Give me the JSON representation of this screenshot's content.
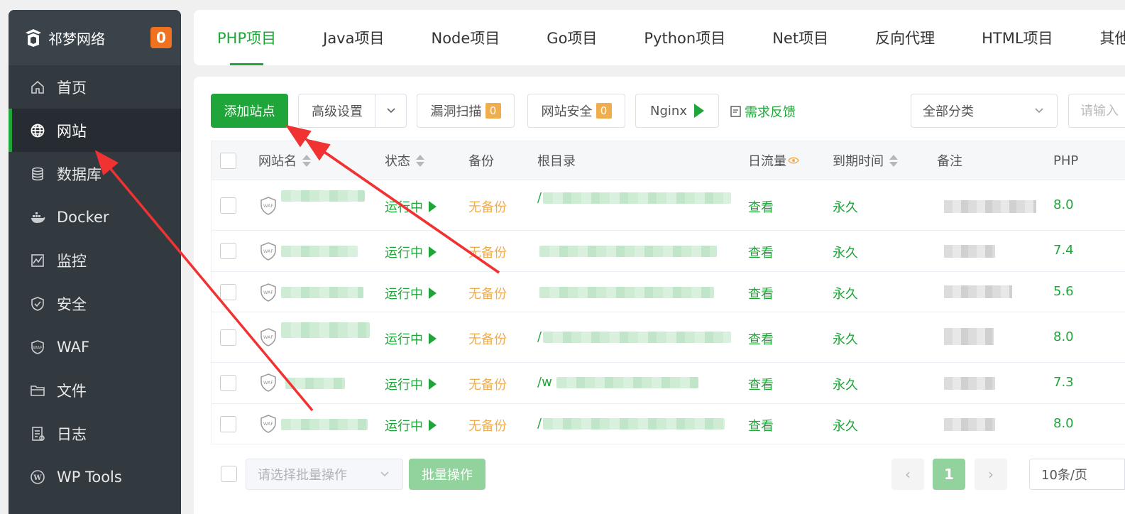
{
  "sidebar": {
    "brand": "祁梦网络",
    "badge": "0",
    "items": [
      {
        "label": "首页",
        "icon": "home-icon"
      },
      {
        "label": "网站",
        "icon": "globe-icon"
      },
      {
        "label": "数据库",
        "icon": "database-icon"
      },
      {
        "label": "Docker",
        "icon": "docker-icon"
      },
      {
        "label": "监控",
        "icon": "monitor-icon"
      },
      {
        "label": "安全",
        "icon": "shield-icon"
      },
      {
        "label": "WAF",
        "icon": "waf-icon"
      },
      {
        "label": "文件",
        "icon": "folder-icon"
      },
      {
        "label": "日志",
        "icon": "log-icon"
      },
      {
        "label": "WP Tools",
        "icon": "wordpress-icon"
      }
    ],
    "active_index": 1
  },
  "tabs": [
    "PHP项目",
    "Java项目",
    "Node项目",
    "Go项目",
    "Python项目",
    "Net项目",
    "反向代理",
    "HTML项目",
    "其他"
  ],
  "toolbar": {
    "add_site": "添加站点",
    "advanced": "高级设置",
    "scan": "漏洞扫描",
    "scan_count": "0",
    "security": "网站安全",
    "security_count": "0",
    "nginx": "Nginx",
    "feedback": "需求反馈",
    "category": "全部分类",
    "search_placeholder": "请输入"
  },
  "table": {
    "headers": {
      "name": "网站名",
      "status": "状态",
      "backup": "备份",
      "root": "根目录",
      "traffic": "日流量",
      "expire": "到期时间",
      "note": "备注",
      "php": "PHP"
    },
    "rows": [
      {
        "status": "运行中",
        "backup": "无备份",
        "root": "/",
        "traffic": "查看",
        "expire": "永久",
        "php": "8.0"
      },
      {
        "status": "运行中",
        "backup": "无备份",
        "root": "",
        "traffic": "查看",
        "expire": "永久",
        "php": "7.4"
      },
      {
        "status": "运行中",
        "backup": "无备份",
        "root": "",
        "traffic": "查看",
        "expire": "永久",
        "php": "5.6"
      },
      {
        "status": "运行中",
        "backup": "无备份",
        "root": "/",
        "traffic": "查看",
        "expire": "永久",
        "php": "8.0"
      },
      {
        "status": "运行中",
        "backup": "无备份",
        "root": "/w",
        "traffic": "查看",
        "expire": "永久",
        "php": "7.3"
      },
      {
        "status": "运行中",
        "backup": "无备份",
        "root": "/",
        "traffic": "查看",
        "expire": "永久",
        "php": "8.0"
      }
    ]
  },
  "footer": {
    "batch_select": "请选择批量操作",
    "batch_button": "批量操作",
    "prev": "‹",
    "page": "1",
    "next": "›",
    "page_size": "10条/页"
  },
  "colors": {
    "accent": "#20a53a",
    "sidebar_bg": "#323a40",
    "warning": "#f0ad4e",
    "badge": "#f0711f"
  }
}
